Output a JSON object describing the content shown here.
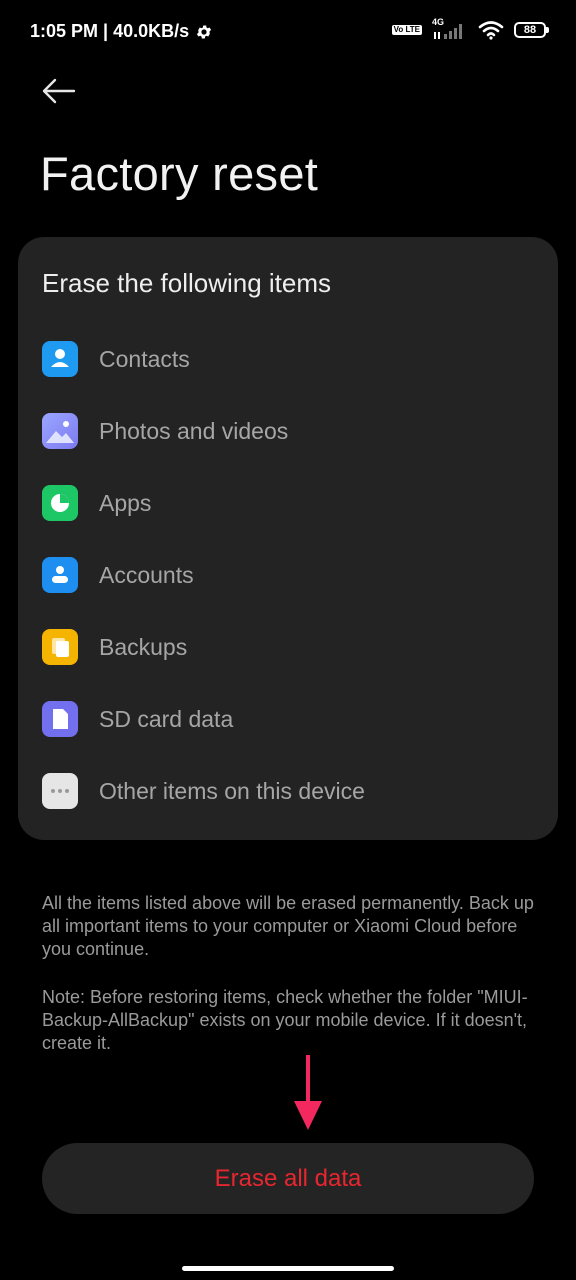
{
  "status_bar": {
    "time_speed": "1:05 PM | 40.0KB/s",
    "volte": "Vo LTE",
    "network": "4G",
    "battery": "88"
  },
  "header": {
    "title": "Factory reset"
  },
  "card": {
    "heading": "Erase the following items",
    "items": [
      {
        "label": "Contacts",
        "icon": "contacts-icon",
        "color": "#1e9bf0"
      },
      {
        "label": "Photos and videos",
        "icon": "photos-icon",
        "color": "#7e8cf5"
      },
      {
        "label": "Apps",
        "icon": "apps-icon",
        "color": "#1ec765"
      },
      {
        "label": "Accounts",
        "icon": "accounts-icon",
        "color": "#1e8ef0"
      },
      {
        "label": "Backups",
        "icon": "backups-icon",
        "color": "#f5b400"
      },
      {
        "label": "SD card data",
        "icon": "sd-card-icon",
        "color": "#7370f0"
      },
      {
        "label": "Other items on this device",
        "icon": "more-icon",
        "color": "#e6e6e6"
      }
    ]
  },
  "notes": {
    "warning": "All the items listed above will be erased permanently. Back up all important items to your computer or Xiaomi Cloud before you continue.",
    "note": "Note: Before restoring items, check whether the folder \"MIUI-Backup-AllBackup\" exists on your mobile device. If it doesn't, create it."
  },
  "actions": {
    "erase_label": "Erase all data"
  },
  "colors": {
    "accent_red": "#e8262f",
    "annotation_pink": "#f2285e",
    "card_bg": "#232323"
  }
}
